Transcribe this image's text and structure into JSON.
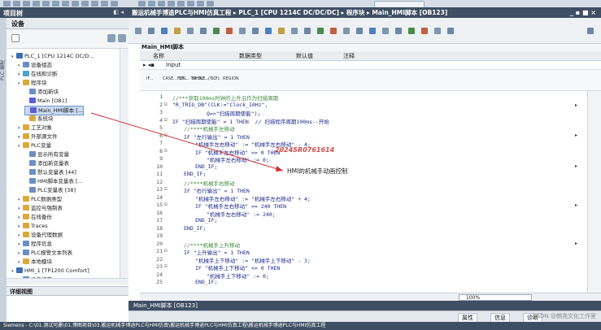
{
  "left_panel": {
    "header": "项目树",
    "devices_label": "设备",
    "details_label": "详细视图",
    "tree": [
      {
        "label": "PLC_1 [CPU 1214C DC/D...",
        "level": 0,
        "color": "#3b6fb5"
      },
      {
        "label": "设备组态",
        "level": 1,
        "color": "#6a8fc4"
      },
      {
        "label": "在线和诊断",
        "level": 1,
        "color": "#4fa3c9"
      },
      {
        "label": "程序块",
        "level": 1,
        "color": "#d9a93a"
      },
      {
        "label": "添加新块",
        "level": 2,
        "color": "#6a8fc4"
      },
      {
        "label": "Main [OB1]",
        "level": 2,
        "color": "#5b5bd6"
      },
      {
        "label": "Main_HMI脚本 [...",
        "level": 2,
        "color": "#5b5bd6",
        "selected": true
      },
      {
        "label": "系统块",
        "level": 2,
        "color": "#d9a93a"
      },
      {
        "label": "工艺对象",
        "level": 1,
        "color": "#d9a93a"
      },
      {
        "label": "外部源文件",
        "level": 1,
        "color": "#d9a93a"
      },
      {
        "label": "PLC变量",
        "level": 1,
        "color": "#d9a93a"
      },
      {
        "label": "显示所有变量",
        "level": 2,
        "color": "#6a8fc4"
      },
      {
        "label": "添加新变量表",
        "level": 2,
        "color": "#6a8fc4"
      },
      {
        "label": "默认变量表 [44]",
        "level": 2,
        "color": "#6a8fc4"
      },
      {
        "label": "HMI脚本变量表 [...",
        "level": 2,
        "color": "#6a8fc4"
      },
      {
        "label": "PLC变量表 [38]",
        "level": 2,
        "color": "#6a8fc4"
      },
      {
        "label": "PLC数据类型",
        "level": 1,
        "color": "#d9a93a"
      },
      {
        "label": "监控与强制表",
        "level": 1,
        "color": "#d9a93a"
      },
      {
        "label": "在线备份",
        "level": 1,
        "color": "#d9a93a"
      },
      {
        "label": "Traces",
        "level": 1,
        "color": "#d9a93a"
      },
      {
        "label": "设备代理数据",
        "level": 1,
        "color": "#d9a93a"
      },
      {
        "label": "程序信息",
        "level": 1,
        "color": "#6a8fc4"
      },
      {
        "label": "PLC报警文本列表",
        "level": 1,
        "color": "#6a8fc4"
      },
      {
        "label": "本地模块",
        "level": 1,
        "color": "#d9a93a"
      },
      {
        "label": "HMI_1 [TP1200 Comfort]",
        "level": 0,
        "color": "#3b6fb5"
      },
      {
        "label": "设备组态",
        "level": 1,
        "color": "#6a8fc4"
      }
    ]
  },
  "titlebar": {
    "breadcrumb": "搬运机械手博途PLC与HMI仿真工程 ▸ PLC_1 [CPU 1214C DC/DC/DC] ▸ 程序块 ▸ Main_HMI脚本 [OB123]",
    "window_controls": "_ ▪ ■ ×"
  },
  "editor": {
    "block_title": "Main_HMI脚本",
    "iface_cols": [
      "名称",
      "数据类型",
      "默认值",
      "注释"
    ],
    "input_row": "Input",
    "instructions": [
      "IF...",
      "CASE... OF...",
      "FOR... TO DO...",
      "WHILE... DO...",
      "(*...*)",
      "REGION"
    ],
    "lines": [
      {
        "n": "1",
        "t": "//***获取100ms时钟的上升沿作为扫描周期",
        "c": "#3b8a3b",
        "ind": 0
      },
      {
        "n": "2",
        "t": "\"R_TRIG_DB\"(CLK:=\"Clock_10Hz\",",
        "c": "#1d2a8a",
        "ind": 0,
        "fold": "⊟"
      },
      {
        "n": "3",
        "t": "Q=>\"扫描周期使能\");",
        "c": "#1d2a8a",
        "ind": 6
      },
      {
        "n": "4",
        "t": "IF \"扫描周期使能\" = 1 THEN  // 扫描程序周期100ms--开始",
        "c": "#1d2a8a",
        "ind": 0,
        "fold": "⊟"
      },
      {
        "n": "5",
        "t": "//****机械手左移动",
        "c": "#3b8a3b",
        "ind": 2
      },
      {
        "n": "6",
        "t": "IF \"左行输出\" = 1 THEN",
        "c": "#1d2a8a",
        "ind": 2,
        "fold": "⊟"
      },
      {
        "n": "7",
        "t": "\"机械手左右移动\" := \"机械手左右移动\" - 4;",
        "c": "#1d2a8a",
        "ind": 4
      },
      {
        "n": "8",
        "t": "IF \"机械手左右移动\" <= 0 THEN",
        "c": "#1d2a8a",
        "ind": 4,
        "fold": "⊟"
      },
      {
        "n": "9",
        "t": "\"机械手左右移动\" := 0;",
        "c": "#1d2a8a",
        "ind": 6
      },
      {
        "n": "10",
        "t": "END_IF;",
        "c": "#1d2a8a",
        "ind": 4
      },
      {
        "n": "11",
        "t": "END_IF;",
        "c": "#1d2a8a",
        "ind": 2
      },
      {
        "n": "12",
        "t": "//****机械手右移动",
        "c": "#3b8a3b",
        "ind": 2
      },
      {
        "n": "13",
        "t": "IF \"右行输出\" = 1 THEN",
        "c": "#1d2a8a",
        "ind": 2,
        "fold": "⊟"
      },
      {
        "n": "14",
        "t": "\"机械手左右移动\" := \"机械手左右移动\" + 4;",
        "c": "#1d2a8a",
        "ind": 4
      },
      {
        "n": "15",
        "t": "IF \"机械手左右移动\" >= 240 THEN",
        "c": "#1d2a8a",
        "ind": 4,
        "fold": "⊟"
      },
      {
        "n": "16",
        "t": "\"机械手左右移动\" := 240;",
        "c": "#1d2a8a",
        "ind": 6
      },
      {
        "n": "17",
        "t": "END_IF;",
        "c": "#1d2a8a",
        "ind": 4
      },
      {
        "n": "18",
        "t": "END_IF;",
        "c": "#1d2a8a",
        "ind": 2
      },
      {
        "n": "19",
        "t": "",
        "c": "#1d2a8a",
        "ind": 0
      },
      {
        "n": "20",
        "t": "//****机械手上升移动",
        "c": "#3b8a3b",
        "ind": 2
      },
      {
        "n": "21",
        "t": "IF \"上升输出\" = 1 THEN",
        "c": "#1d2a8a",
        "ind": 2,
        "fold": "⊟"
      },
      {
        "n": "22",
        "t": "\"机械手上下移动\" := \"机械手上下移动\" - 3;",
        "c": "#1d2a8a",
        "ind": 4
      },
      {
        "n": "23",
        "t": "IF \"机械手上下移动\" <= 0 THEN",
        "c": "#1d2a8a",
        "ind": 4,
        "fold": "⊟"
      },
      {
        "n": "24",
        "t": "\"机械手上下移动\" := 0;",
        "c": "#1d2a8a",
        "ind": 6
      },
      {
        "n": "25",
        "t": "END_IF;",
        "c": "#1d2a8a",
        "ind": 4
      }
    ],
    "annotation": "HMI的机械手动画控制",
    "overlay_mark": "2024SR0761614",
    "zoom": "100%"
  },
  "bottom": {
    "editor_tab": "Main_HMI脚本 [OB123]",
    "props": [
      "属性",
      "信息",
      "诊断"
    ],
    "watermark": "CSDN @朗尧文化工作室"
  },
  "statusbar": "Siemens - C:\\01.测试可删\\01.博图项目\\03.搬运机械手博途PLC与HMI仿真\\搬运机械手博途PLC与HMI仿真工程\\搬运机械手博途PLC与HMI仿真工程",
  "colors": {
    "accent": "#3f4f63",
    "arrow": "#d03030"
  }
}
